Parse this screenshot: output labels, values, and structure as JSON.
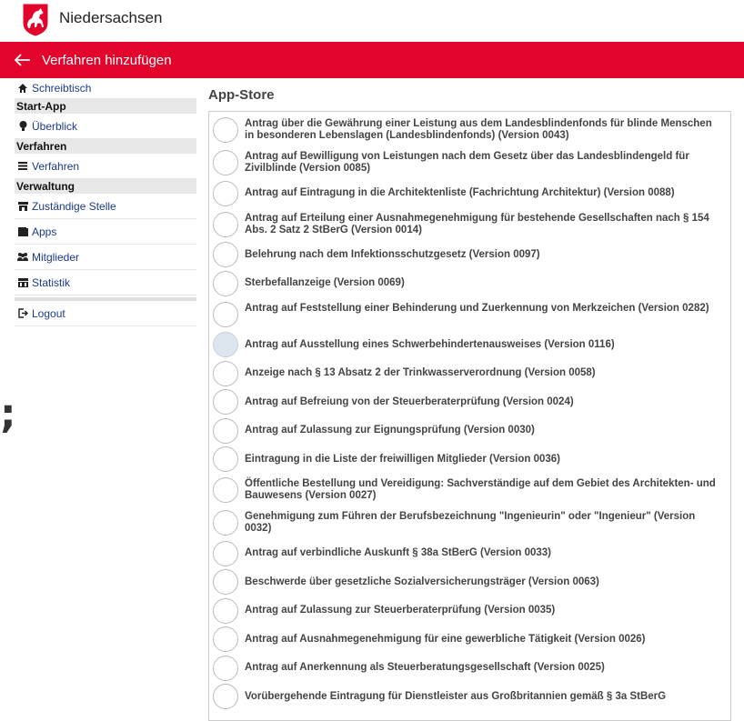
{
  "brand": {
    "name": "Niedersachsen"
  },
  "header": {
    "title": "Verfahren hinzufügen"
  },
  "sidebar": {
    "items": [
      {
        "type": "item",
        "icon": "home-icon",
        "label": "Schreibtisch"
      },
      {
        "type": "header",
        "label": "Start-App"
      },
      {
        "type": "item",
        "icon": "lightbulb-icon",
        "label": "Überblick"
      },
      {
        "type": "header",
        "label": "Verfahren"
      },
      {
        "type": "item",
        "icon": "list-icon",
        "label": "Verfahren"
      },
      {
        "type": "header",
        "label": "Verwaltung"
      },
      {
        "type": "item",
        "icon": "building-icon",
        "label": "Zuständige Stelle"
      },
      {
        "type": "item",
        "icon": "book-icon",
        "label": "Apps"
      },
      {
        "type": "item",
        "icon": "users-icon",
        "label": "Mitglieder"
      },
      {
        "type": "item",
        "icon": "chart-icon",
        "label": "Statistik"
      },
      {
        "type": "separator"
      },
      {
        "type": "item",
        "icon": "logout-icon",
        "label": "Logout"
      }
    ]
  },
  "main": {
    "title": "App-Store",
    "selected_index": 7,
    "items": [
      "Antrag über die Gewährung einer Leistung aus dem Landesblindenfonds für blinde Menschen in besonderen Lebenslagen (Landesblindenfonds) (Version 0043)",
      "Antrag auf Bewilligung von Leistungen nach dem Gesetz über das Landesblindengeld für Zivilblinde (Version 0085)",
      "Antrag auf Eintragung in die Architektenliste (Fachrichtung Architektur) (Version 0088)",
      "Antrag auf Erteilung einer Ausnahmegenehmigung für bestehende Gesellschaften nach § 154 Abs. 2 Satz 2 StBerG (Version 0014)",
      "Belehrung nach dem Infektionsschutzgesetz (Version 0097)",
      "Sterbefallanzeige (Version 0069)",
      "Antrag auf Feststellung einer Behinderung und Zuerkennung von Merkzeichen (Version 0282)",
      "Antrag auf Ausstellung eines Schwerbehindertenausweises (Version 0116)",
      "Anzeige nach § 13 Absatz 2 der Trinkwasserverordnung (Version 0058)",
      "Antrag auf Befreiung von der Steuerberaterprüfung (Version 0024)",
      "Antrag auf Zulassung zur Eignungsprüfung (Version 0030)",
      "Eintragung in die Liste der freiwilligen Mitglieder (Version 0036)",
      "Öffentliche Bestellung und Vereidigung: Sachverständige auf dem Gebiet des Architekten- und Bauwesens (Version 0027)",
      "Genehmigung zum Führen der Berufsbezeichnung \"Ingenieurin\" oder \"Ingenieur\" (Version 0032)",
      "Antrag auf verbindliche Auskunft § 38a StBerG (Version 0033)",
      "Beschwerde über gesetzliche Sozialversicherungsträger (Version 0063)",
      "Antrag auf Zulassung zur Steuerberaterprüfung (Version 0035)",
      "Antrag auf Ausnahmegenehmigung für eine gewerbliche Tätigkeit (Version 0026)",
      "Antrag auf Anerkennung als Steuerberatungsgesellschaft (Version 0025)",
      "Vorübergehende Eintragung für Dienstleister aus Großbritannien gemäß § 3a StBerG"
    ]
  },
  "colors": {
    "accent": "#e3042b",
    "link": "#1a3a8a",
    "selected_radio": "#dde6ee"
  },
  "background_glyph": ";"
}
